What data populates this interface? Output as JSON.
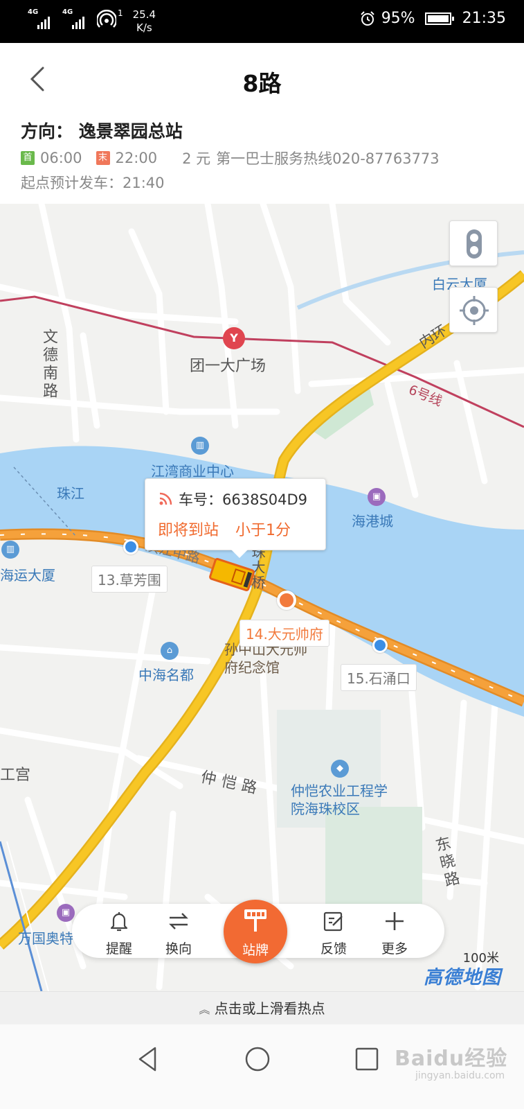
{
  "status_bar": {
    "sim1": "4G",
    "sim2": "4G",
    "hotspot_count": "1",
    "speed_value": "25.4",
    "speed_unit": "K/s",
    "battery": "95%",
    "time": "21:35"
  },
  "header": {
    "title": "8路"
  },
  "route": {
    "direction_label": "方向：",
    "direction_value": "逸景翠园总站",
    "first_badge": "首",
    "first_time": "06:00",
    "last_badge": "末",
    "last_time": "22:00",
    "fare": "2 元",
    "hotline": "第一巴士服务热线020-87763773",
    "departure": "起点预计发车：21:40"
  },
  "map": {
    "labels": {
      "baiyun": "白云大厦",
      "tuanyi": "团一大广场",
      "wende_road": "文德南路",
      "inner_ring": "内环",
      "line6": "6号线",
      "jiangwan": "江湾商业中心",
      "pearl_river": "珠江",
      "haigang": "海港城",
      "haiyun": "海运大厦",
      "zhonghai": "中海名都",
      "memorial": "孙中山大元帅府纪念馆",
      "zhongkai_road": "仲恺路",
      "zhongkai_college": "仲恺农业工程学院海珠校区",
      "dongxiao_road": "东晓路",
      "wanguo": "万国奥特",
      "palace_fragment": "工宫",
      "binjiang": "滨江中路",
      "bridge": "海珠大桥"
    },
    "bus_popup": {
      "plate_label": "车号：",
      "plate_value": "6638S04D9",
      "status": "即将到站",
      "eta": "小于1分"
    },
    "stops": [
      {
        "label": "13.草芳围",
        "current": false
      },
      {
        "label": "14.大元帅府",
        "current": true
      },
      {
        "label": "15.石涌口",
        "current": false
      }
    ],
    "scale": "100米",
    "provider": "高德地图"
  },
  "toolbar": {
    "remind": "提醒",
    "switch": "换向",
    "station_board": "站牌",
    "feedback": "反馈",
    "more": "更多"
  },
  "hot_spots": "点击或上滑看热点",
  "watermark": {
    "brand": "Baidu经验",
    "url": "jingyan.baidu.com"
  },
  "colors": {
    "accent_orange": "#f26a33",
    "route_orange": "#f5a13b",
    "stop_blue": "#3b8ee5",
    "river_blue": "#a9d4f5",
    "highway_yellow": "#f7c625",
    "metro_red": "#c0405e"
  }
}
